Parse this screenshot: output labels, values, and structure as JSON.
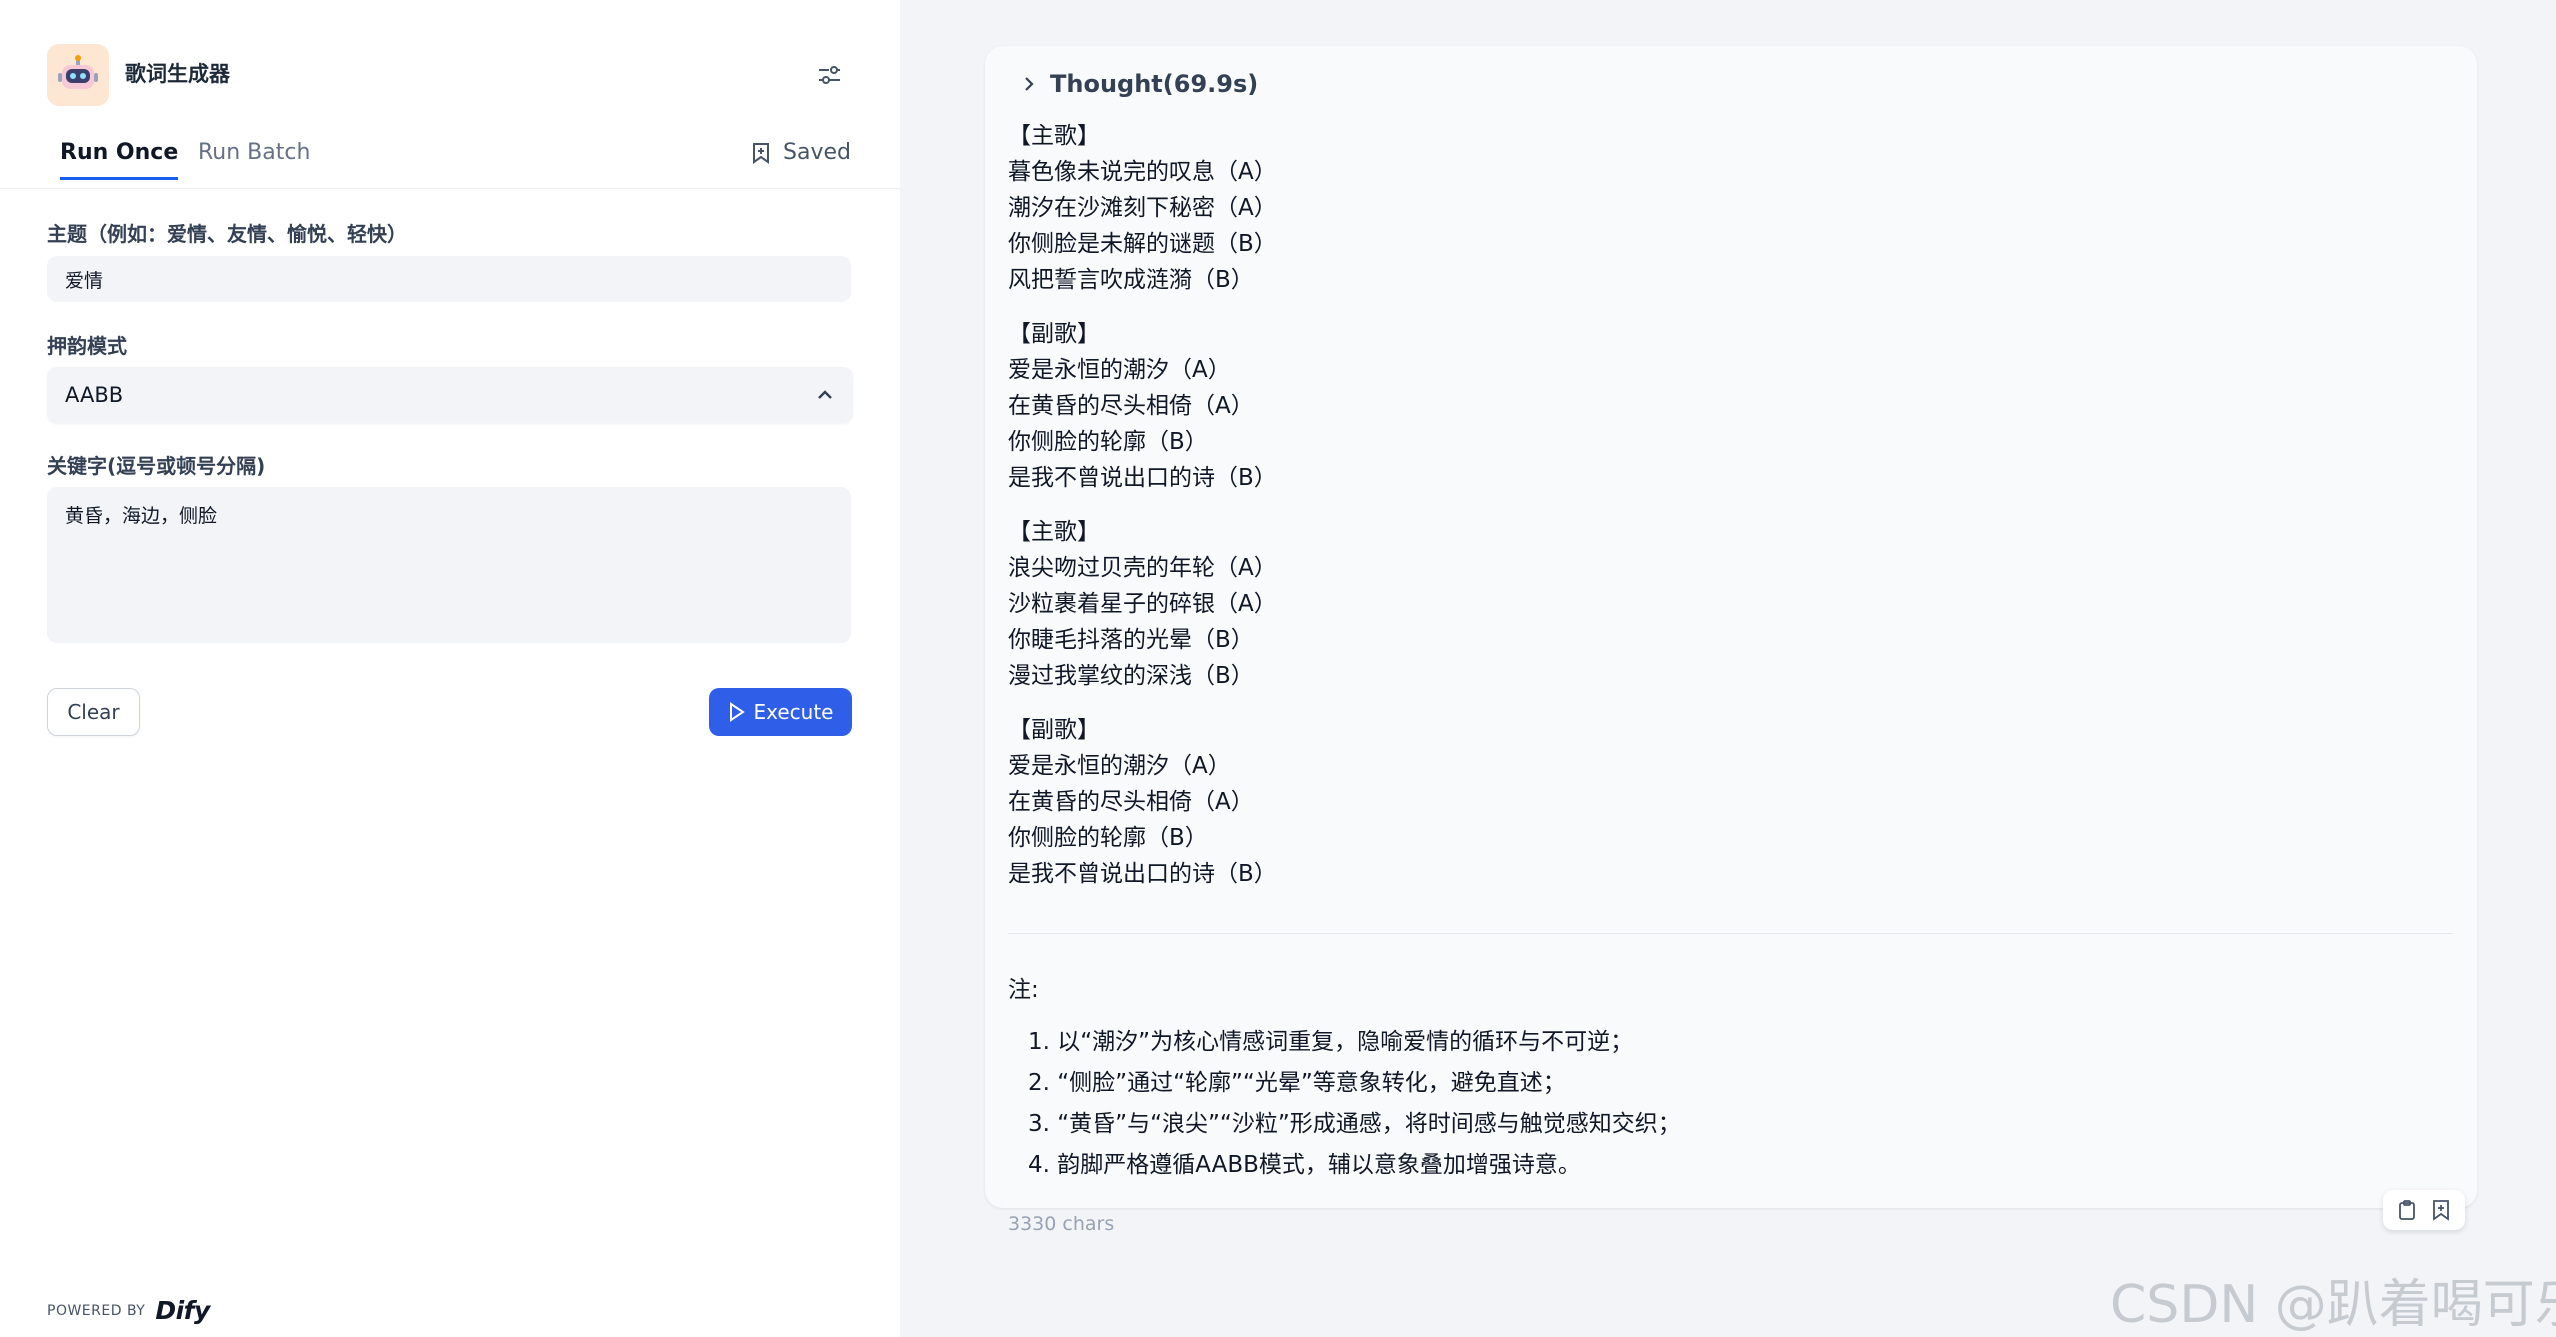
{
  "app": {
    "title": "歌词生成器"
  },
  "tabs": [
    {
      "label": "Run Once"
    },
    {
      "label": "Run Batch"
    }
  ],
  "saved_label": "Saved",
  "form": {
    "theme": {
      "label": "主题（例如：爱情、友情、愉悦、轻快）",
      "value": "爱情"
    },
    "rhyme": {
      "label": "押韵模式",
      "value": "AABB"
    },
    "keywords": {
      "label": "关键字(逗号或顿号分隔)",
      "value": "黄昏，海边，侧脸"
    }
  },
  "buttons": {
    "clear": "Clear",
    "execute": "Execute"
  },
  "footer": {
    "powered_by": "POWERED BY",
    "brand": "Dify"
  },
  "output": {
    "thought": "Thought(69.9s)",
    "stanzas": [
      {
        "lines": [
          "【主歌】",
          "暮色像未说完的叹息（A）",
          "潮汐在沙滩刻下秘密（A）",
          "你侧脸是未解的谜题（B）",
          "风把誓言吹成涟漪（B）"
        ]
      },
      {
        "lines": [
          "【副歌】",
          "爱是永恒的潮汐（A）",
          "在黄昏的尽头相倚（A）",
          "你侧脸的轮廓（B）",
          "是我不曾说出口的诗（B）"
        ]
      },
      {
        "lines": [
          "【主歌】",
          "浪尖吻过贝壳的年轮（A）",
          "沙粒裹着星子的碎银（A）",
          "你睫毛抖落的光晕（B）",
          "漫过我掌纹的深浅（B）"
        ]
      },
      {
        "lines": [
          "【副歌】",
          "爱是永恒的潮汐（A）",
          "在黄昏的尽头相倚（A）",
          "你侧脸的轮廓（B）",
          "是我不曾说出口的诗（B）"
        ]
      }
    ],
    "note_title": "注:",
    "notes": [
      "1. 以“潮汐”为核心情感词重复，隐喻爱情的循环与不可逆；",
      "2. “侧脸”通过“轮廓”“光晕”等意象转化，避免直述；",
      "3. “黄昏”与“浪尖”“沙粒”形成通感，将时间感与触觉感知交织；",
      "4. 韵脚严格遵循AABB模式，辅以意象叠加增强诗意。"
    ],
    "char_count": "3330 chars"
  },
  "watermark": "CSDN @趴着喝可乐",
  "colors": {
    "primary": "#2f5fe8",
    "tab_underline": "#155eef",
    "panel_bg": "#f2f4f7"
  }
}
